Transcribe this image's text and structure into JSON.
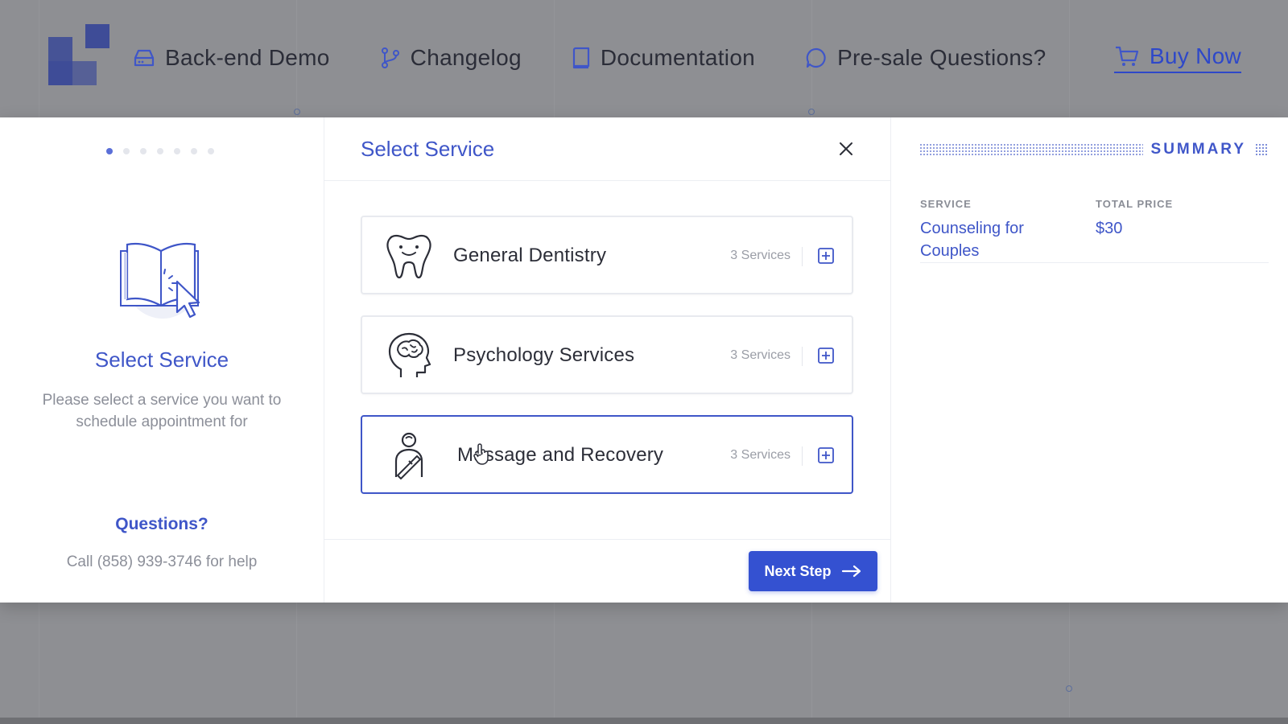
{
  "nav": {
    "items": [
      {
        "label": "Back-end Demo",
        "icon": "hard-drive-icon"
      },
      {
        "label": "Changelog",
        "icon": "git-branch-icon"
      },
      {
        "label": "Documentation",
        "icon": "book-icon"
      },
      {
        "label": "Pre-sale Questions?",
        "icon": "chat-bubble-icon"
      },
      {
        "label": "Buy Now",
        "icon": "cart-icon"
      }
    ]
  },
  "left_panel": {
    "title": "Select Service",
    "description": "Please select a service you want to schedule appointment for",
    "questions_title": "Questions?",
    "questions_text": "Call (858) 939-3746 for help",
    "steps_total": 7,
    "active_step": 1
  },
  "main": {
    "title": "Select Service",
    "services": [
      {
        "name": "General Dentistry",
        "count": "3 Services",
        "icon": "tooth-icon",
        "selected": false
      },
      {
        "name": "Psychology Services",
        "count": "3 Services",
        "icon": "brain-head-icon",
        "selected": false
      },
      {
        "name": "Massage and Recovery",
        "count": "3 Services",
        "icon": "massage-person-icon",
        "selected": true
      }
    ],
    "next_button": "Next Step"
  },
  "summary": {
    "title": "SUMMARY",
    "service_label": "SERVICE",
    "service_value": "Counseling for Couples",
    "price_label": "TOTAL PRICE",
    "price_value": "$30"
  },
  "colors": {
    "accent": "#3f56c8",
    "button": "#3451d1",
    "overlay_bg": "#8e8f93",
    "logo": "#3e4c97"
  }
}
